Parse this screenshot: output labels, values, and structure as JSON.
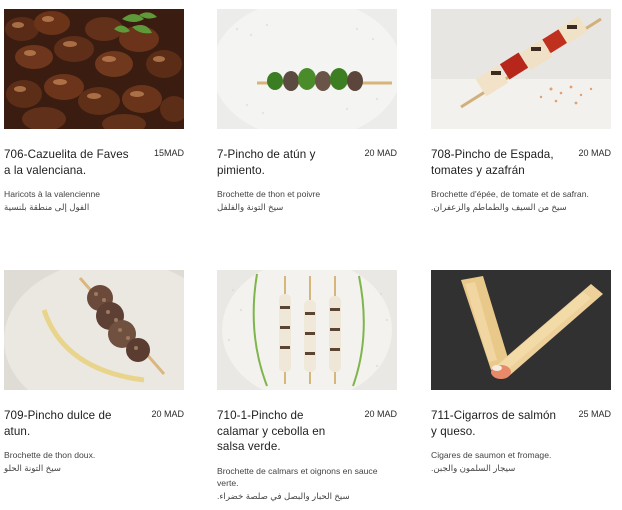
{
  "menu": {
    "items": [
      {
        "name": "706-Cazuelita de Faves a la valenciana.",
        "price": "15MAD",
        "description": "Haricots à la valencienne",
        "description_ar": "الفول إلى منطقة بلنسية",
        "image_icon": "beans-dish-photo"
      },
      {
        "name": "7-Pincho de atún y pimiento.",
        "price": "20 MAD",
        "description": "Brochette de thon et poivre",
        "description_ar": "سيخ التونة والفلفل",
        "image_icon": "tuna-skewer-photo"
      },
      {
        "name": "708-Pincho de Espada, tomates y azafrán",
        "price": "20 MAD",
        "description": "Brochette d'épée, de tomate et de safran.",
        "description_ar": "سيخ من السيف والطماطم والزعفران.",
        "image_icon": "swordfish-skewer-photo"
      },
      {
        "name": "709-Pincho dulce de atun.",
        "price": "20 MAD",
        "description": "Brochette de thon doux.",
        "description_ar": "سيخ التونة الحلو",
        "image_icon": "sweet-tuna-skewer-photo"
      },
      {
        "name": "710-1-Pincho de calamar y cebolla en salsa verde.",
        "price": "20 MAD",
        "description": "Brochette de calmars et oignons en sauce verte.",
        "description_ar": "سيخ الحبار والبصل في صلصة خضراء.",
        "image_icon": "squid-skewers-photo"
      },
      {
        "name": "711-Cigarros de salmón y queso.",
        "price": "25 MAD",
        "description": "Cigares de saumon et fromage.",
        "description_ar": "سيجار السلمون والجبن.",
        "image_icon": "salmon-cigars-photo"
      }
    ]
  }
}
